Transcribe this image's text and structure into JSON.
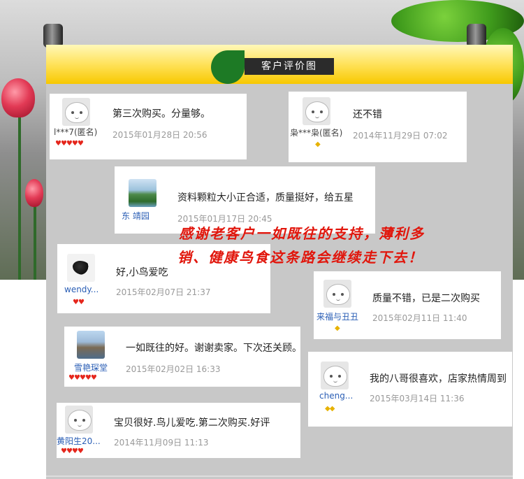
{
  "header": {
    "title": "客户评价图"
  },
  "reviews": [
    {
      "user": "l***7(匿名)",
      "text": "第三次购买。分量够。",
      "date": "2015年01月28日 20:56",
      "rating": "♥♥♥♥♥",
      "avatar_icon": "default-face-icon"
    },
    {
      "user": "枭***枭(匿名)",
      "text": "还不错",
      "date": "2014年11月29日 07:02",
      "rating": "◆",
      "avatar_icon": "default-face-icon"
    },
    {
      "user": "东 靖园",
      "text": "资料颗粒大小正合适，质量挺好，给五星",
      "date": "2015年01月17日 20:45",
      "rating": "",
      "avatar_icon": "landscape-photo"
    },
    {
      "user": "wendy...",
      "text": "好,小鸟爱吃",
      "date": "2015年02月07日 21:37",
      "rating": "♥♥",
      "avatar_icon": "bird-photo"
    },
    {
      "user": "来福与丑丑",
      "text": "质量不错，已是二次购买",
      "date": "2015年02月11日 11:40",
      "rating": "◆",
      "avatar_icon": "default-face-icon"
    },
    {
      "user": "雪艳琛堂",
      "text": "一如既往的好。谢谢卖家。下次还关顾。",
      "date": "2015年02月02日 16:33",
      "rating": "♥♥♥♥♥",
      "avatar_icon": "people-photo"
    },
    {
      "user": "cheng...",
      "text": "我的八哥很喜欢，店家热情周到",
      "date": "2015年03月14日 11:36",
      "rating": "◆◆",
      "avatar_icon": "default-face-icon"
    },
    {
      "user": "黄阳生20...",
      "text": "宝贝很好.鸟儿爱吃.第二次购买.好评",
      "date": "2014年11月09日 11:13",
      "rating": "♥♥♥♥",
      "avatar_icon": "default-face-icon"
    }
  ],
  "promo": {
    "line1": "感谢老客户一如既往的支持，薄利多",
    "line2": "销、健康鸟食这条路会继续走下去！"
  },
  "colors": {
    "promo": "#e1160c",
    "header_band": "#f7c800",
    "board": "#c8c8c8"
  }
}
